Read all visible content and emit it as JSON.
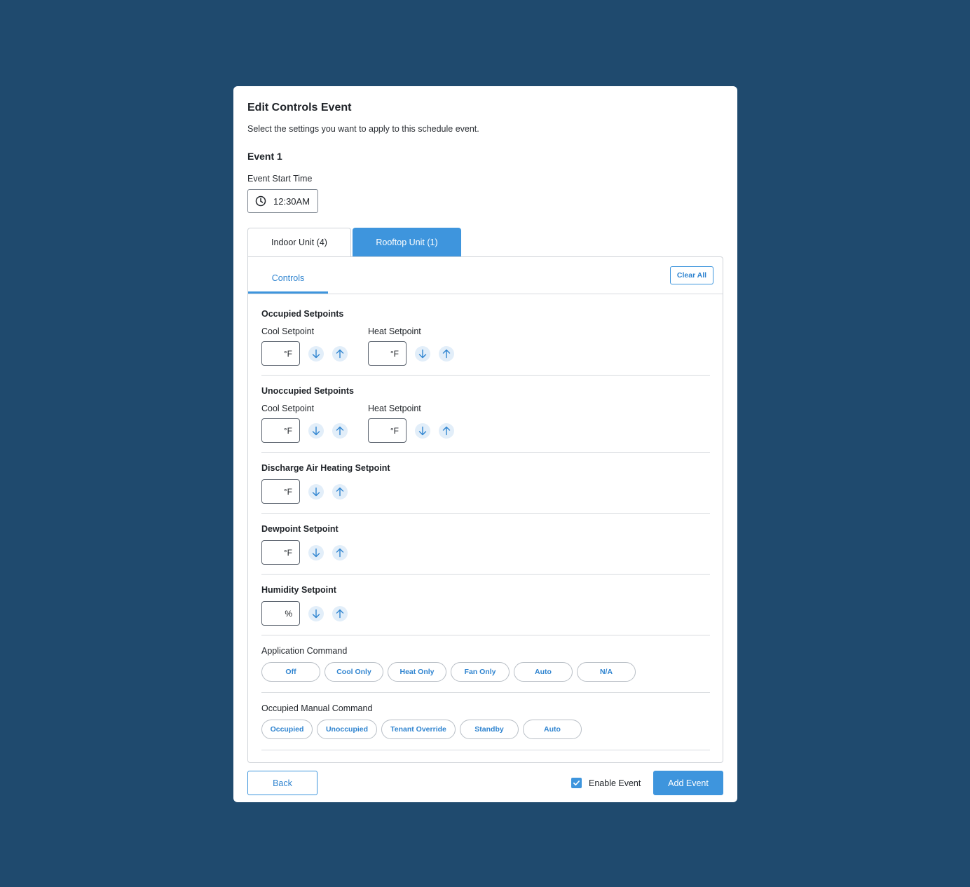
{
  "modal": {
    "title": "Edit Controls Event",
    "subtitle": "Select the settings you want to apply to this schedule event.",
    "event_label": "Event 1",
    "start_time_label": "Event Start Time",
    "start_time_value": "12:30AM"
  },
  "tabs": {
    "indoor": "Indoor Unit (4)",
    "rooftop": "Rooftop Unit (1)",
    "active": "rooftop"
  },
  "panel": {
    "controls_tab": "Controls",
    "clear_all": "Clear All"
  },
  "sections": {
    "occupied": {
      "title": "Occupied Setpoints",
      "cool_label": "Cool Setpoint",
      "cool_unit": "°F",
      "heat_label": "Heat Setpoint",
      "heat_unit": "°F"
    },
    "unoccupied": {
      "title": "Unoccupied Setpoints",
      "cool_label": "Cool Setpoint",
      "cool_unit": "°F",
      "heat_label": "Heat Setpoint",
      "heat_unit": "°F"
    },
    "discharge": {
      "title": "Discharge Air Heating Setpoint",
      "unit": "°F"
    },
    "dewpoint": {
      "title": "Dewpoint Setpoint",
      "unit": "°F"
    },
    "humidity": {
      "title": "Humidity Setpoint",
      "unit": "%"
    },
    "application_command": {
      "title": "Application Command",
      "options": [
        "Off",
        "Cool Only",
        "Heat Only",
        "Fan Only",
        "Auto",
        "N/A"
      ]
    },
    "occupied_manual_command": {
      "title": "Occupied Manual Command",
      "options": [
        "Occupied",
        "Unoccupied",
        "Tenant Override",
        "Standby",
        "Auto"
      ]
    }
  },
  "footer": {
    "back": "Back",
    "enable_event": "Enable Event",
    "enable_checked": true,
    "add_event": "Add Event"
  },
  "colors": {
    "background": "#1f4a6e",
    "accent": "#3e95dd",
    "accent_text": "#2f84d0"
  },
  "icons": {
    "clock": "clock-icon",
    "down": "arrow-down-icon",
    "up": "arrow-up-icon",
    "check": "check-icon"
  }
}
